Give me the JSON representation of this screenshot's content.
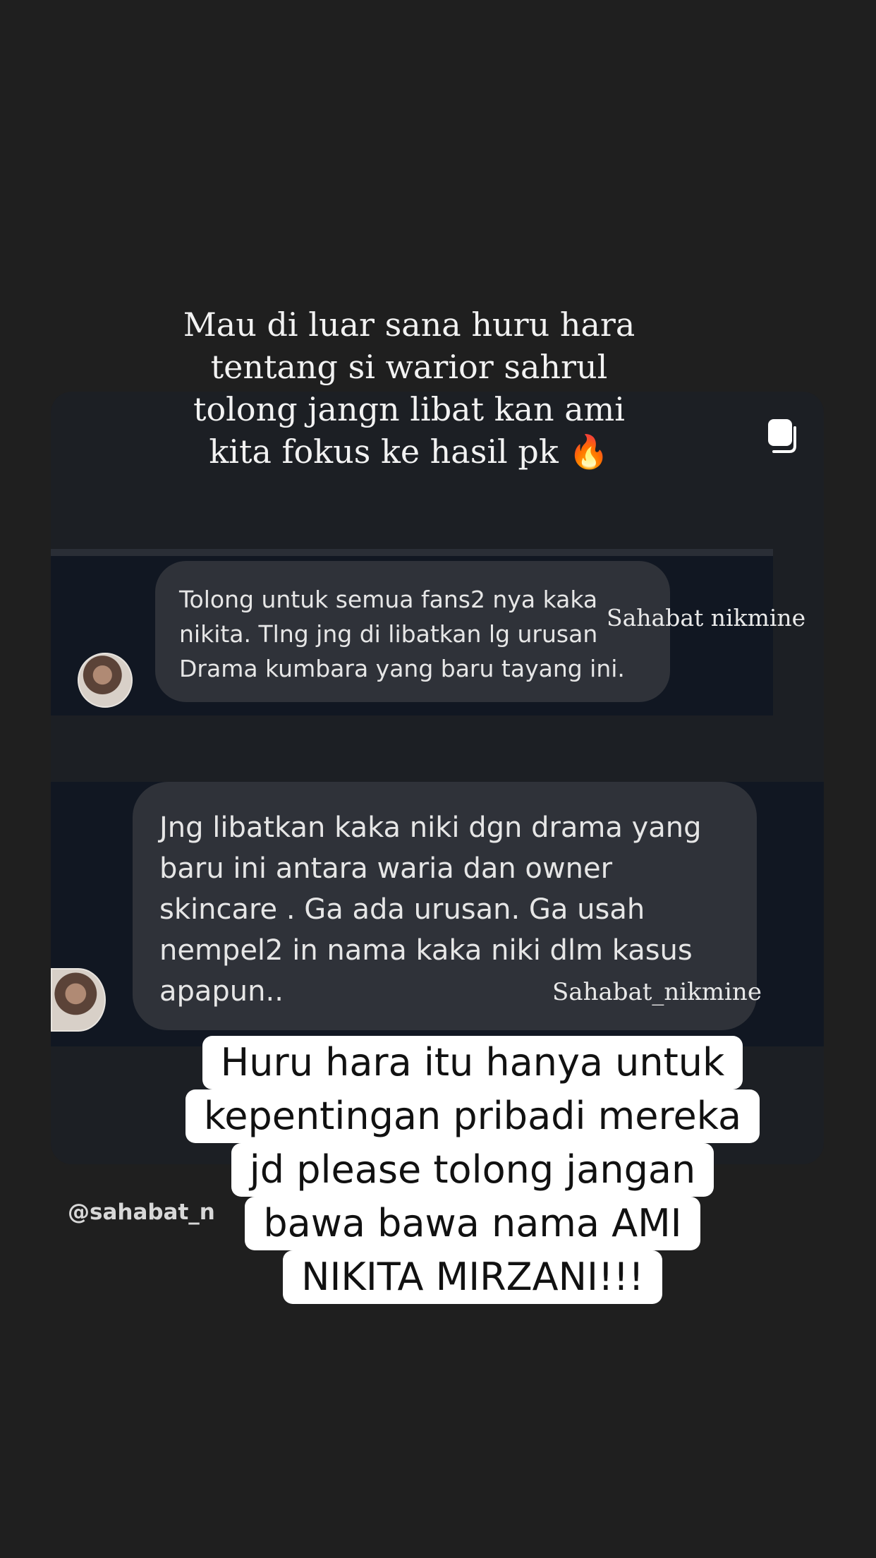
{
  "headline": {
    "lines": [
      "Mau di luar sana huru hara",
      "tentang si warior sahrul",
      "tolong jangn libat kan ami",
      "kita fokus ke hasil pk 🔥"
    ]
  },
  "messages": [
    {
      "lines": [
        "Tolong untuk semua fans2 nya kaka",
        "nikita. Tlng jng di libatkan lg urusan",
        "Drama kumbara yang baru tayang ini."
      ],
      "watermark": "Sahabat nikmine"
    },
    {
      "lines": [
        "Jng libatkan kaka niki dgn drama yang",
        "baru ini antara waria dan owner",
        "skincare . Ga ada urusan. Ga usah",
        "nempel2 in nama kaka niki dlm kasus",
        "apapun.."
      ],
      "watermark": "Sahabat_nikmine"
    }
  ],
  "handle": "@sahabat_nikmine",
  "caption": {
    "lines": [
      "Huru hara itu hanya untuk",
      "kepentingan pribadi mereka",
      "jd please tolong jangan",
      "bawa bawa nama AMI",
      "NIKITA MIRZANI!!!"
    ]
  },
  "icons": {
    "copy": "copy-icon",
    "avatar": "profile-avatar"
  }
}
